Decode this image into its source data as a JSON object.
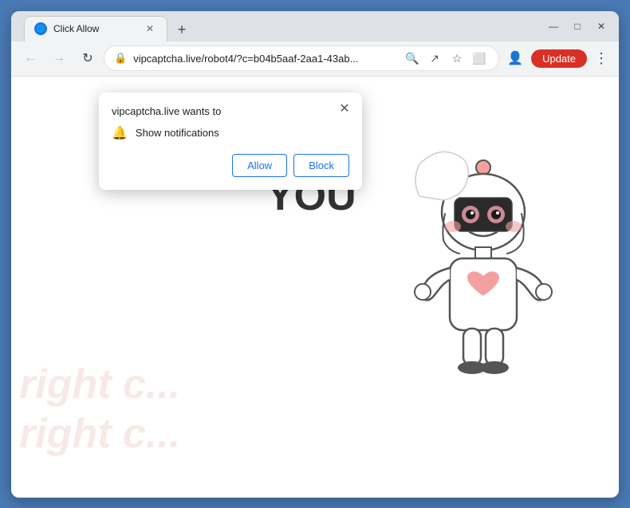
{
  "browser": {
    "tab_title": "Click Allow",
    "tab_favicon": "🌐",
    "new_tab_symbol": "+",
    "window_controls": {
      "minimize": "—",
      "maximize": "□",
      "close": "✕"
    }
  },
  "navbar": {
    "back_symbol": "←",
    "forward_symbol": "→",
    "refresh_symbol": "↻",
    "url": "vipcaptcha.live/robot4/?c=b04b5aaf-2aa1-43ab...",
    "lock_symbol": "🔒",
    "search_symbol": "🔍",
    "share_symbol": "↗",
    "bookmark_symbol": "☆",
    "split_symbol": "⬜",
    "profile_symbol": "👤",
    "update_label": "Update",
    "more_symbol": "⋮"
  },
  "popup": {
    "title": "vipcaptcha.live wants to",
    "close_symbol": "✕",
    "notification_icon": "🔔",
    "notification_text": "Show notifications",
    "allow_label": "Allow",
    "block_label": "Block"
  },
  "page": {
    "you_text": "YOU",
    "watermark_lines": [
      "right c...",
      "right c..."
    ]
  },
  "colors": {
    "allow_btn_border": "#1a73e8",
    "allow_btn_text": "#1a73e8",
    "block_btn_border": "#1a73e8",
    "block_btn_text": "#1a73e8",
    "update_btn_bg": "#d93025",
    "update_btn_text": "#ffffff"
  }
}
